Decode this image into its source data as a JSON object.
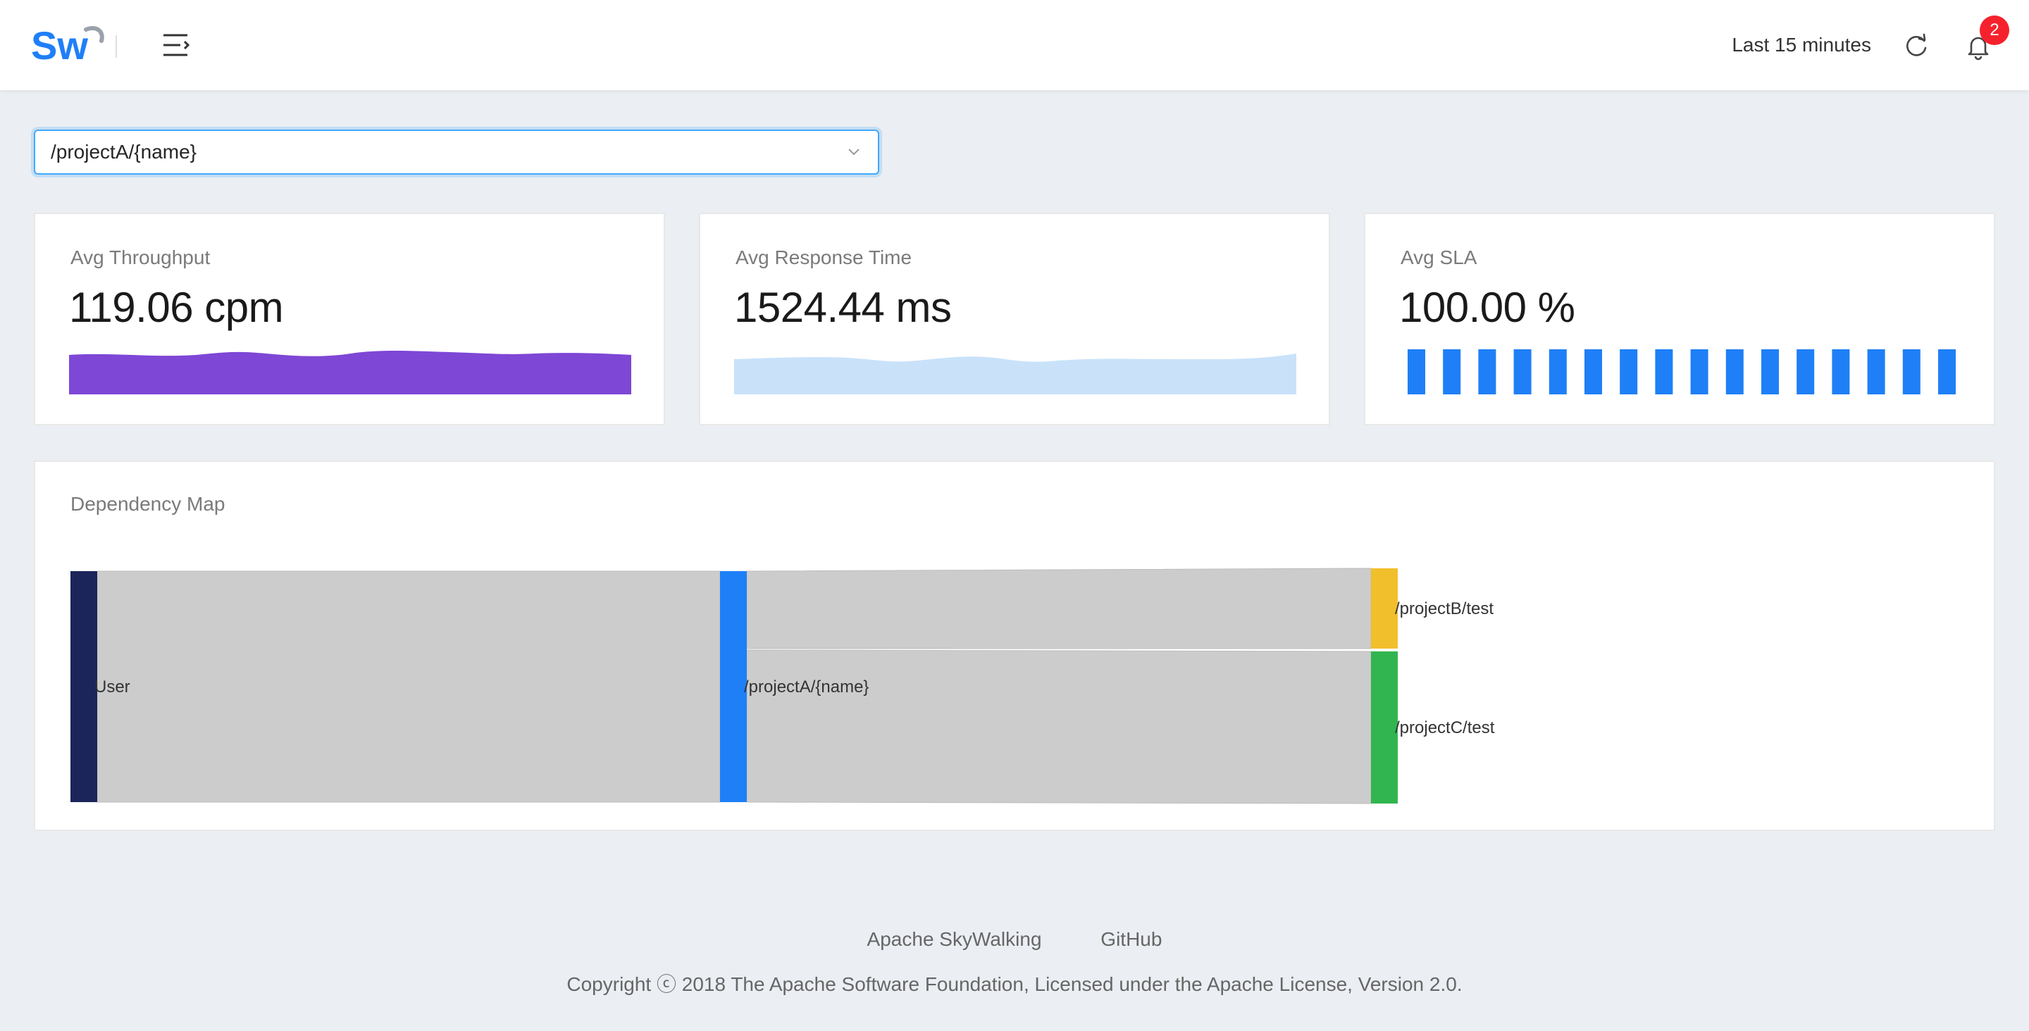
{
  "header": {
    "logo_text": "Sw",
    "time_range": "Last 15 minutes",
    "notification_count": "2"
  },
  "endpoint_select": {
    "value": "/projectA/{name}"
  },
  "cards": {
    "throughput": {
      "title": "Avg Throughput",
      "value": "119.06 cpm",
      "color": "#7e47d6"
    },
    "response_time": {
      "title": "Avg Response Time",
      "value": "1524.44 ms",
      "color": "#c9e2fa"
    },
    "sla": {
      "title": "Avg SLA",
      "value": "100.00 %",
      "color": "#1f7ff7"
    }
  },
  "dependency_map": {
    "title": "Dependency Map",
    "nodes": [
      {
        "name": "User",
        "color": "#1b2559"
      },
      {
        "name": "/projectA/{name}",
        "color": "#1f7ff7"
      },
      {
        "name": "/projectB/test",
        "color": "#f2bf2c"
      },
      {
        "name": "/projectC/test",
        "color": "#31b550"
      }
    ],
    "links": [
      {
        "source": "User",
        "target": "/projectA/{name}",
        "value": 100
      },
      {
        "source": "/projectA/{name}",
        "target": "/projectB/test",
        "value": 34
      },
      {
        "source": "/projectA/{name}",
        "target": "/projectC/test",
        "value": 66
      }
    ]
  },
  "footer": {
    "link_skywalking": "Apache SkyWalking",
    "link_github": "GitHub",
    "copyright": "Copyright ⓒ 2018 The Apache Software Foundation, Licensed under the Apache License, Version 2.0."
  }
}
